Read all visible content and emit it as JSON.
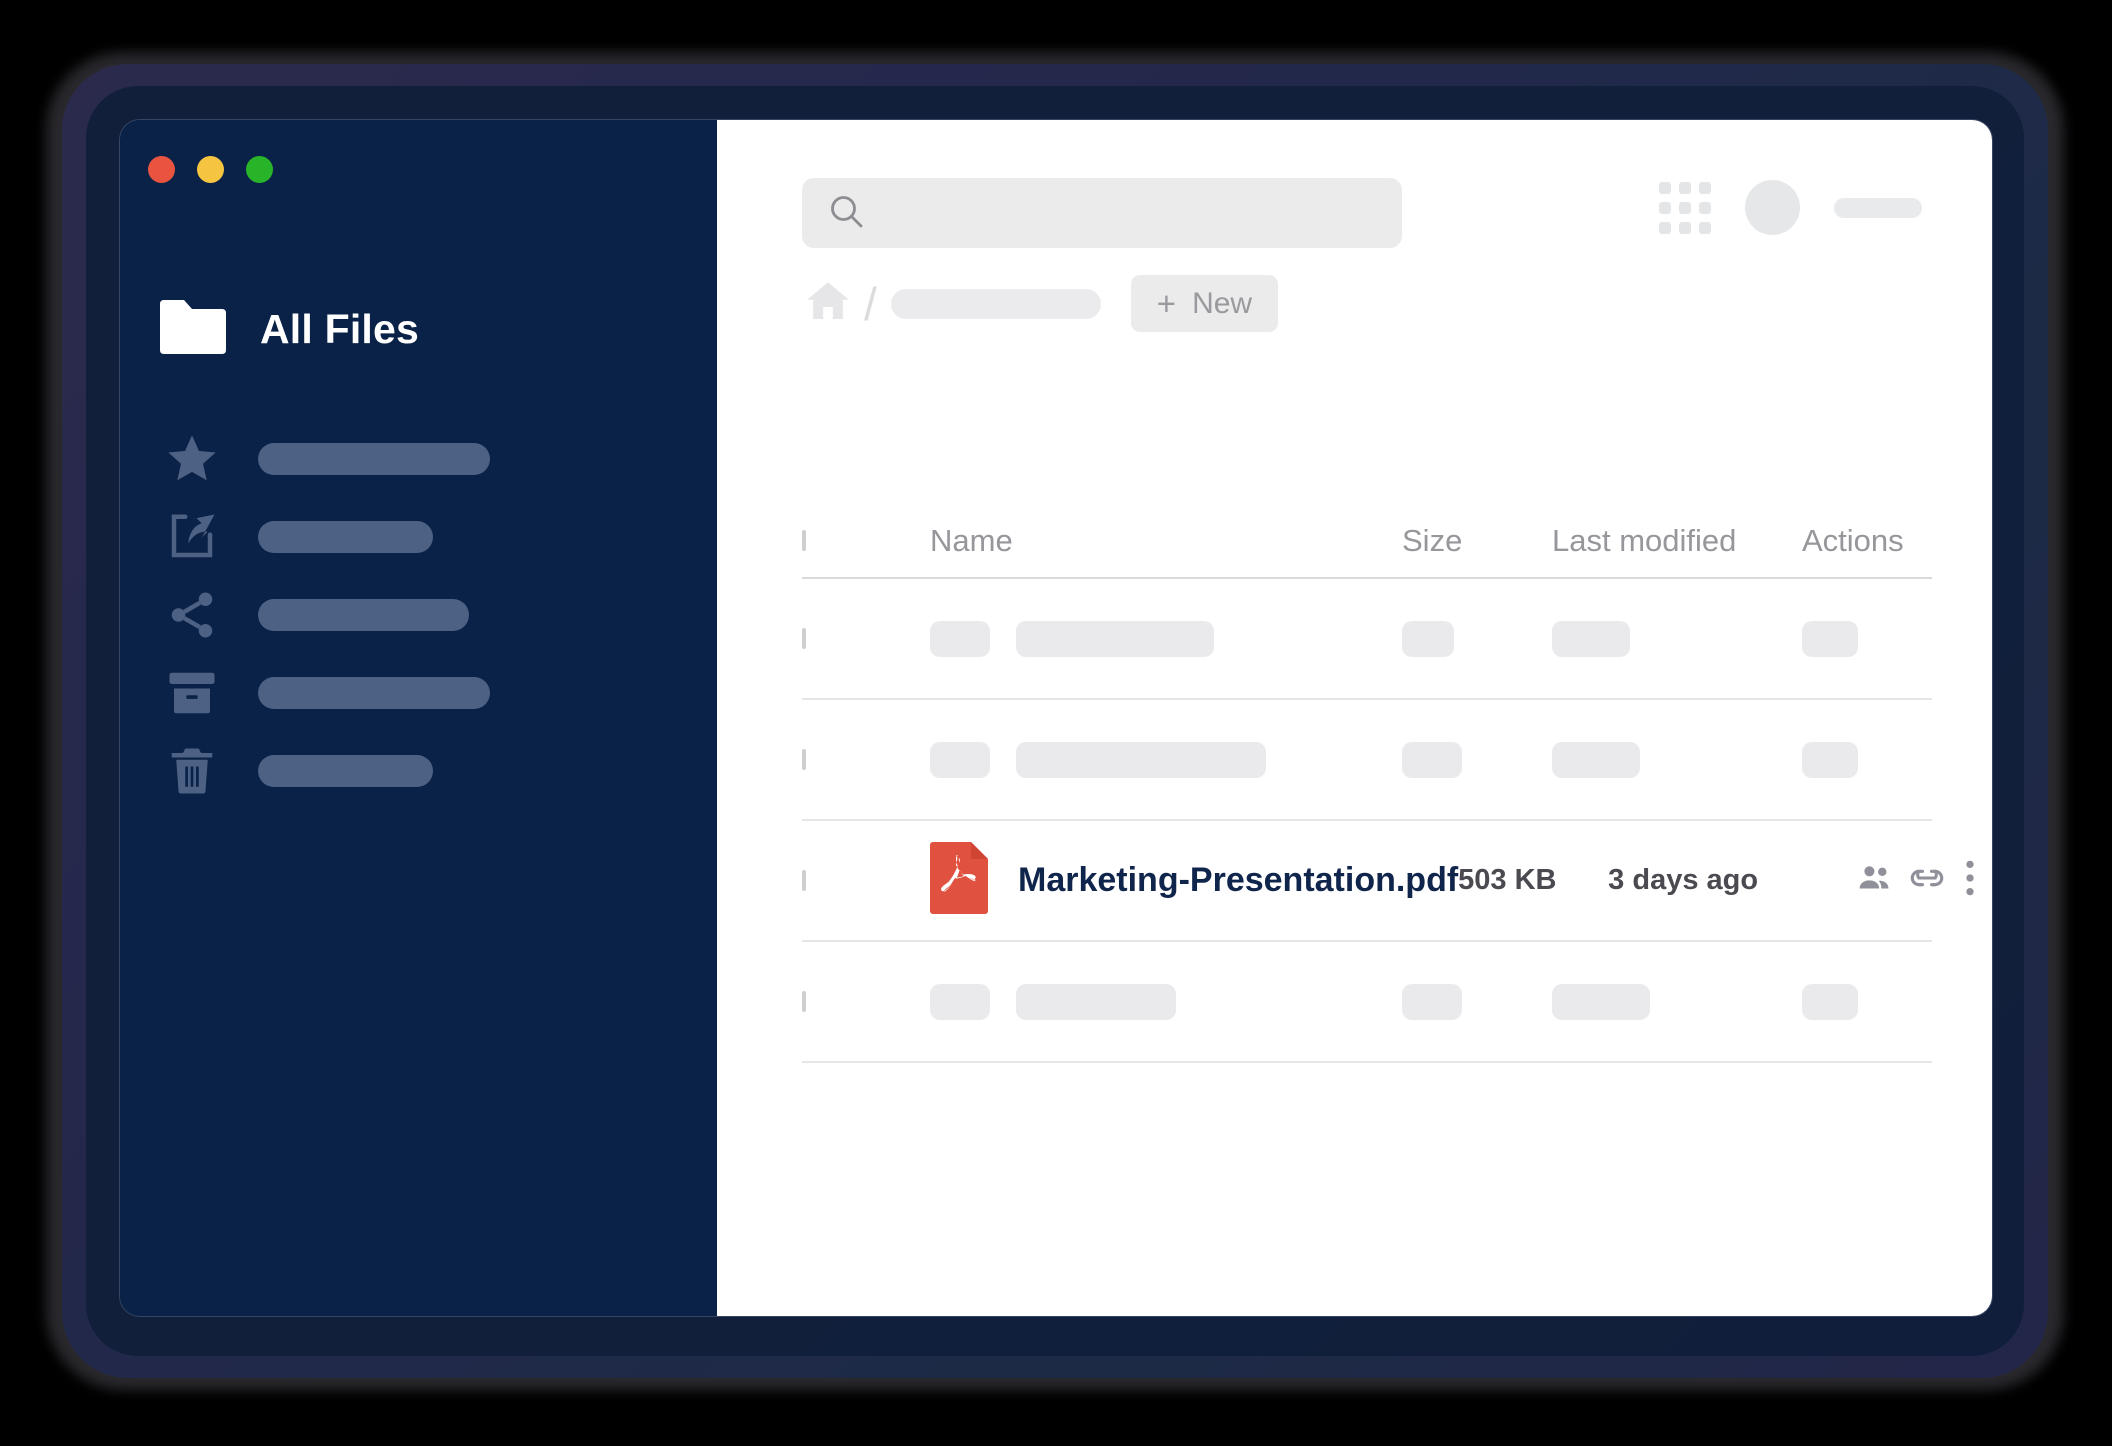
{
  "window": {
    "traffic_lights": [
      {
        "name": "close",
        "color": "#e8543f"
      },
      {
        "name": "minimize",
        "color": "#f5c542"
      },
      {
        "name": "maximize",
        "color": "#28b428"
      }
    ]
  },
  "sidebar": {
    "brand_label": "All Files",
    "brand_icon": "folder-icon",
    "background": "#0a2247",
    "items": [
      {
        "icon": "star-icon",
        "label": "",
        "pill_width": 232
      },
      {
        "icon": "export-icon",
        "label": "",
        "pill_width": 175
      },
      {
        "icon": "share-icon",
        "label": "",
        "pill_width": 211
      },
      {
        "icon": "archive-icon",
        "label": "",
        "pill_width": 232
      },
      {
        "icon": "trash-icon",
        "label": "",
        "pill_width": 175
      }
    ]
  },
  "header": {
    "search": {
      "placeholder": "",
      "value": "",
      "icon": "search-icon"
    },
    "apps_icon": "grid-apps-icon",
    "avatar": "user-avatar",
    "user_name": ""
  },
  "breadcrumb": {
    "home_icon": "home-icon",
    "separator": "/",
    "current_crumb": "",
    "new_button": {
      "label": "New",
      "plus": "+"
    }
  },
  "table": {
    "columns": [
      "",
      "Name",
      "Size",
      "Last modified",
      "Actions"
    ],
    "rows": [
      {
        "type": "skeleton",
        "name_width": 198,
        "size_width": 52,
        "mod_width": 78,
        "act_width": 56
      },
      {
        "type": "skeleton",
        "name_width": 250,
        "size_width": 60,
        "mod_width": 88,
        "act_width": 56
      },
      {
        "type": "file",
        "icon": "pdf-file-icon",
        "icon_color": "#e0513f",
        "name": "Marketing-Presentation.pdf",
        "size": "503 KB",
        "modified": "3 days ago",
        "actions": [
          "people-icon",
          "link-icon",
          "kebab-menu-icon"
        ]
      },
      {
        "type": "skeleton",
        "name_width": 160,
        "size_width": 60,
        "mod_width": 98,
        "act_width": 56
      }
    ]
  },
  "footer": {
    "ghost_bar": ""
  },
  "colors": {
    "sidebar_bg": "#0a2247",
    "sidebar_pill": "#4c6183",
    "accent_pdf": "#e0513f",
    "filename_text": "#10254b",
    "placeholder_grey": "#eaeaec"
  }
}
